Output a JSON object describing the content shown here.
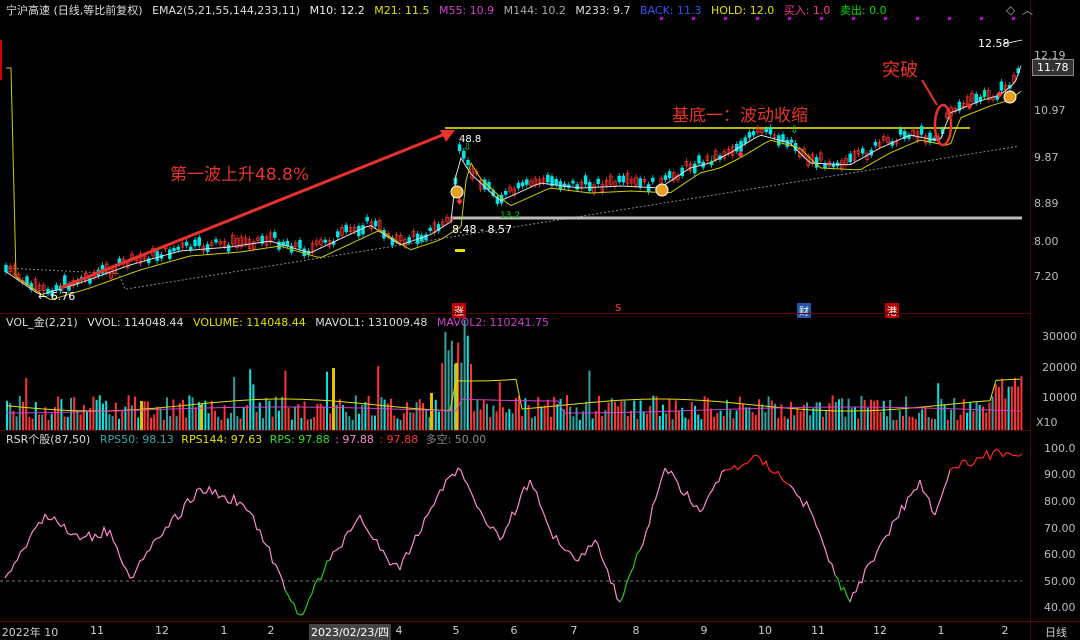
{
  "main_header": {
    "symbol": "宁沪高速 (日线,等比前复权)",
    "indicator": "EMA2(5,21,55,144,233,11)",
    "m10": "M10: 12.2",
    "m21": "M21: 11.5",
    "m55": "M55: 10.9",
    "m144": "M144: 10.2",
    "m233": "M233: 9.7",
    "back": "BACK: 11.3",
    "hold": "HOLD: 12.0",
    "buy": "买入: 1.0",
    "sell": "卖出: 0.0"
  },
  "price_axis": [
    "12.19",
    "10.97",
    "9.87",
    "8.89",
    "8.00",
    "7.20"
  ],
  "last_price": "11.78",
  "annotations": {
    "wave": "第一波上升48.8%",
    "base": "基底一：波动收缩",
    "breakout": "突破",
    "high_label": "12.58",
    "low_label": "6.76",
    "base_high": "48.8",
    "base_range": "8.48 - 8.57",
    "small_num": "13.2"
  },
  "event_markers": [
    "涨",
    "S",
    "财",
    "港"
  ],
  "vol_header": {
    "name": "VOL_金(2,21)",
    "vvol": "VVOL: 114048.44",
    "volume": "VOLUME: 114048.44",
    "mavol1": "MAVOL1: 131009.48",
    "mavol2": "MAVOL2: 110241.75"
  },
  "vol_axis": [
    "30000",
    "20000",
    "10000"
  ],
  "vol_unit": "X10",
  "rsr_header": {
    "name": "RSR个股(87,50)",
    "rps50": "RPS50: 98.13",
    "rps144": "RPS144: 97.63",
    "rps": "RPS: 97.88",
    "rps_val": ": 97.88",
    "rps_val2": ": 97.88",
    "duokong": "多空: 50.00"
  },
  "rsr_axis": [
    "100.0",
    "90.00",
    "80.00",
    "70.00",
    "60.00",
    "50.00",
    "40.00"
  ],
  "x_axis": [
    "2022年 10",
    "11",
    "12",
    "1",
    "2",
    "2023/02/23/四",
    "4",
    "5",
    "6",
    "7",
    "8",
    "9",
    "10",
    "11",
    "12",
    "1",
    "2"
  ],
  "period_label": "日线",
  "colors": {
    "up": "#ff3333",
    "down": "#00e5e5",
    "pink": "#ff88cc",
    "yellow": "#e0e000",
    "magenta": "#d040d0"
  }
}
